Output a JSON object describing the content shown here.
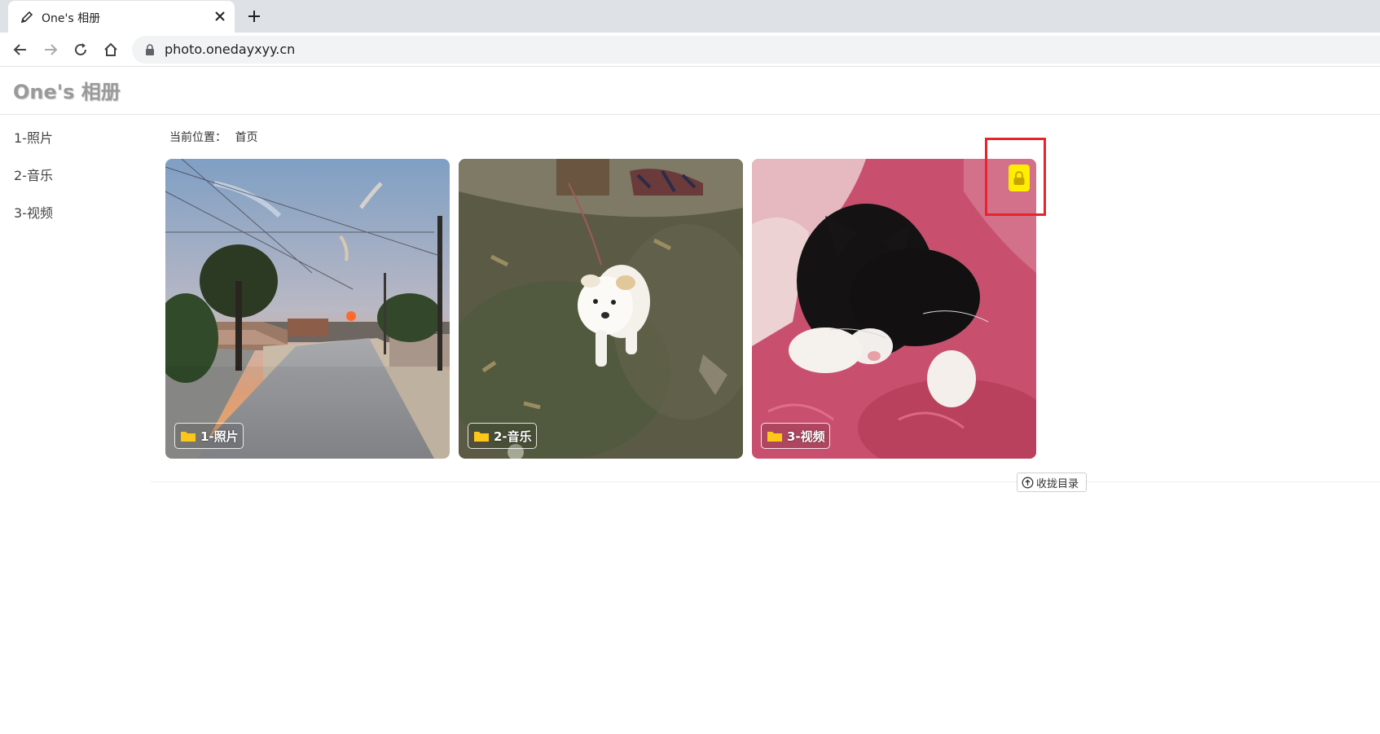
{
  "browser": {
    "tab_title": "One's 相册",
    "url": "photo.onedayxyy.cn"
  },
  "site": {
    "title": "One's 相册"
  },
  "sidebar": {
    "items": [
      {
        "label": "1-照片"
      },
      {
        "label": "2-音乐"
      },
      {
        "label": "3-视频"
      }
    ]
  },
  "breadcrumb": {
    "label": "当前位置：",
    "current": "首页"
  },
  "albums": [
    {
      "label": "1-照片",
      "locked": false
    },
    {
      "label": "2-音乐",
      "locked": false
    },
    {
      "label": "3-视频",
      "locked": true
    }
  ],
  "collapse_button": {
    "label": "收拢目录"
  },
  "colors": {
    "lock_badge": "#ffee00",
    "highlight_box": "#e8242b",
    "folder_icon": "#ffc61a"
  }
}
